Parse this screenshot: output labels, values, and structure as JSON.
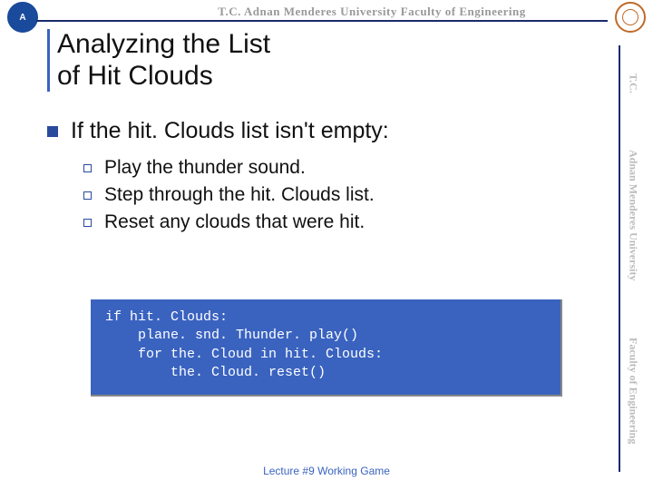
{
  "header": {
    "text": "T.C.    Adnan Menderes University    Faculty of Engineering"
  },
  "sidebar": {
    "lines": [
      "T.C.",
      "Adnan Menderes University",
      "Faculty of Engineering"
    ]
  },
  "title": {
    "line1": "Analyzing the List",
    "line2": "of Hit Clouds"
  },
  "bullet": {
    "main": "If the hit. Clouds list isn't empty:",
    "subs": [
      "Play the thunder sound.",
      "Step through the hit. Clouds list.",
      "Reset any clouds that were hit."
    ]
  },
  "code": "if hit. Clouds:\n    plane. snd. Thunder. play()\n    for the. Cloud in hit. Clouds:\n        the. Cloud. reset()",
  "footer": "Lecture #9 Working Game"
}
